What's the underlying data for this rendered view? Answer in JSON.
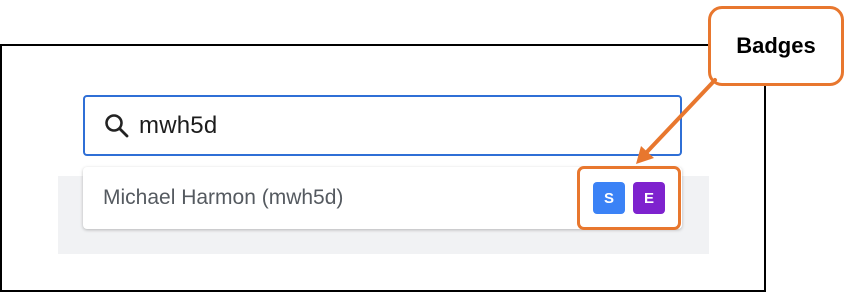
{
  "search": {
    "value": "mwh5d",
    "icon": "search-icon"
  },
  "results": [
    {
      "label": "Michael Harmon (mwh5d)",
      "badges": [
        {
          "letter": "S",
          "color": "#3b82f6"
        },
        {
          "letter": "E",
          "color": "#7e22ce"
        }
      ]
    }
  ],
  "callout": {
    "label": "Badges"
  },
  "colors": {
    "accent_border": "#2f6fd6",
    "annotation": "#e8772e"
  }
}
